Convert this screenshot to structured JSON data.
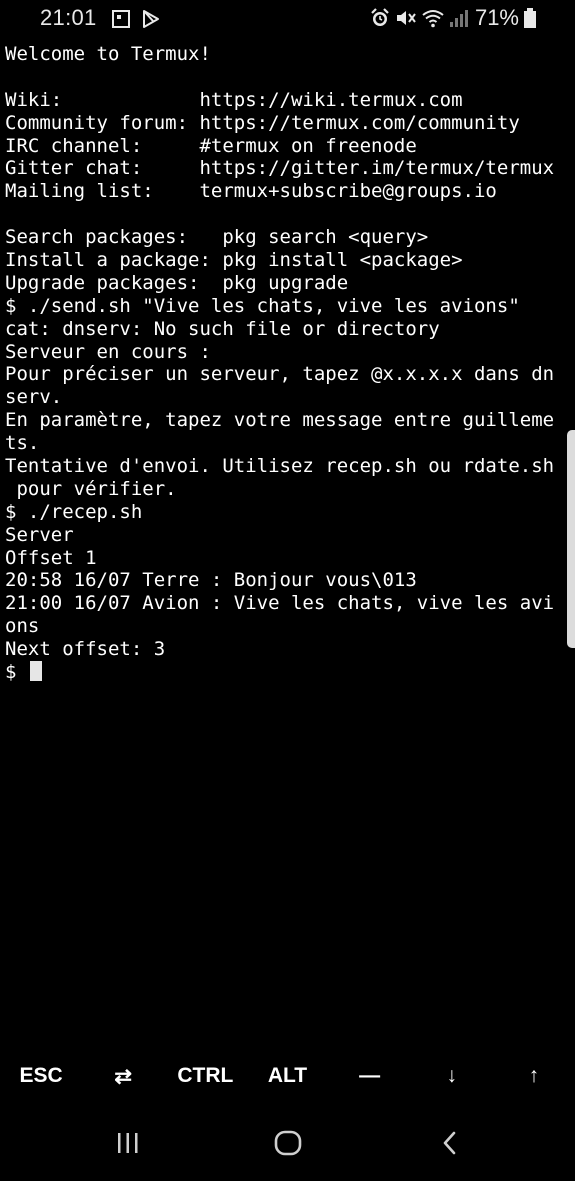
{
  "status_bar": {
    "time": "21:01",
    "battery_percent": "71%",
    "left_icons": [
      "screenshot-icon",
      "play-store-icon"
    ],
    "right_icons": [
      "alarm-icon",
      "mute-icon",
      "wifi-icon",
      "signal-icon",
      "battery-icon"
    ],
    "battery_level": 0.71
  },
  "terminal": {
    "lines": [
      "Welcome to Termux!",
      "",
      "Wiki:            https://wiki.termux.com",
      "Community forum: https://termux.com/community",
      "IRC channel:     #termux on freenode",
      "Gitter chat:     https://gitter.im/termux/termux",
      "Mailing list:    termux+subscribe@groups.io",
      "",
      "Search packages:   pkg search <query>",
      "Install a package: pkg install <package>",
      "Upgrade packages:  pkg upgrade",
      "$ ./send.sh \"Vive les chats, vive les avions\"",
      "cat: dnserv: No such file or directory",
      "Serveur en cours :",
      "Pour préciser un serveur, tapez @x.x.x.x dans dn",
      "serv.",
      "En paramètre, tapez votre message entre guilleme",
      "ts.",
      "Tentative d'envoi. Utilisez recep.sh ou rdate.sh",
      " pour vérifier.",
      "$ ./recep.sh",
      "Server",
      "Offset 1",
      "20:58 16/07 Terre : Bonjour vous\\013",
      "21:00 16/07 Avion : Vive les chats, vive les avi",
      "ons",
      "Next offset: 3"
    ],
    "prompt": "$ "
  },
  "extra_keys": {
    "esc": "ESC",
    "tab": "⇄",
    "ctrl": "CTRL",
    "alt": "ALT",
    "dash": "—",
    "down": "↓",
    "up": "↑"
  },
  "nav_bar": {
    "icons": [
      "recent-apps-icon",
      "home-icon",
      "back-icon"
    ]
  },
  "colors": {
    "background": "#000000",
    "text": "#ffffff",
    "cursor": "#e6e6e6"
  }
}
